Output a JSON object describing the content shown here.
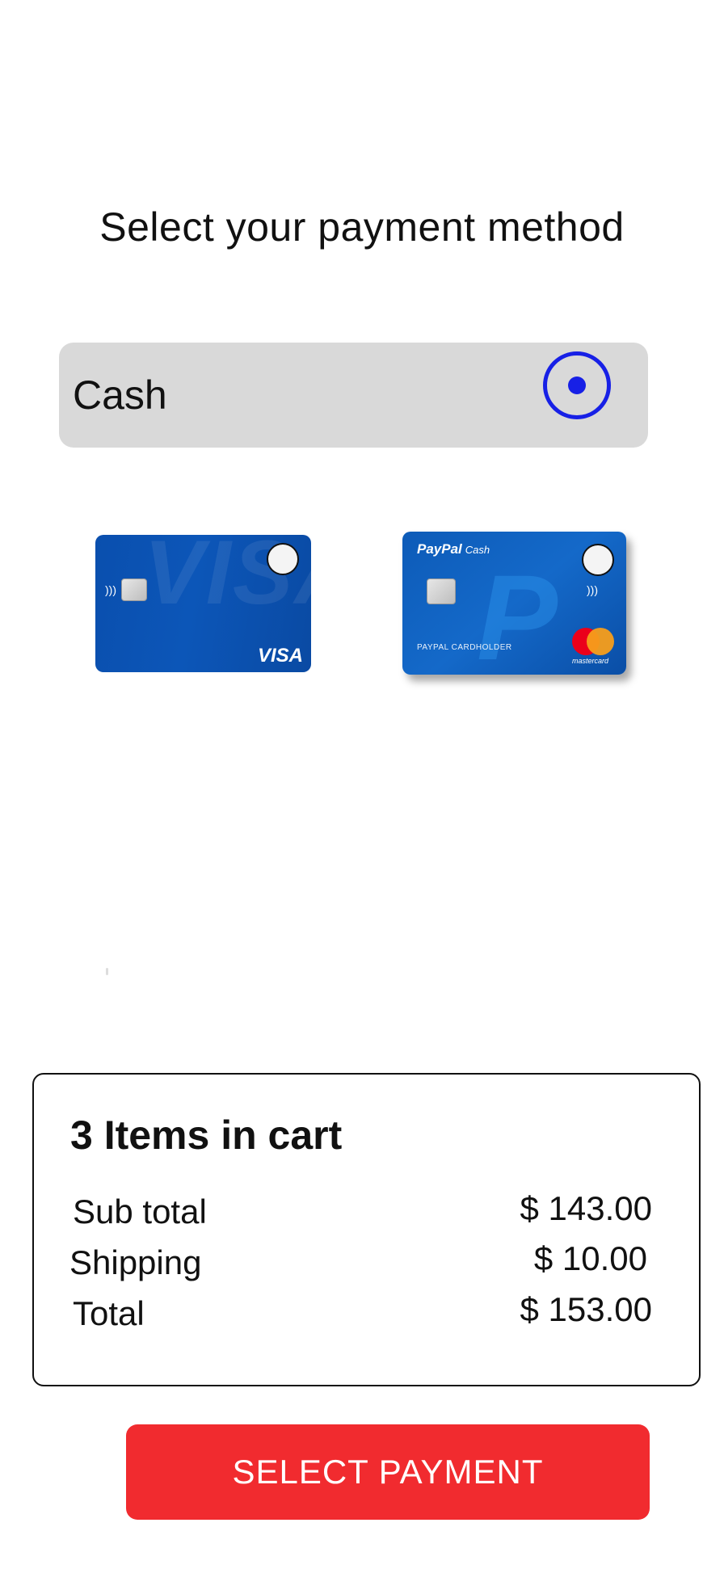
{
  "title": "Select your payment method",
  "cash_option": {
    "label": "Cash",
    "selected": true
  },
  "cards": [
    {
      "name": "Visa",
      "logo_text": "VISA",
      "watermark": "VISA",
      "selected": false
    },
    {
      "name": "PayPal Cash",
      "brand": "PayPal",
      "brand_sub": "Cash",
      "holder": "PAYPAL CARDHOLDER",
      "network": "mastercard",
      "watermark": "P",
      "selected": false
    }
  ],
  "summary": {
    "title": "3 Items in cart",
    "subtotal_label": "Sub total",
    "subtotal_value": "$ 143.00",
    "shipping_label": "Shipping",
    "shipping_value": "$ 10.00",
    "total_label": "Total",
    "total_value": "$ 153.00"
  },
  "cta_label": "SELECT PAYMENT",
  "colors": {
    "accent_radio": "#1720e6",
    "cta_bg": "#f12b2f",
    "option_bg": "#d9d9d9"
  }
}
